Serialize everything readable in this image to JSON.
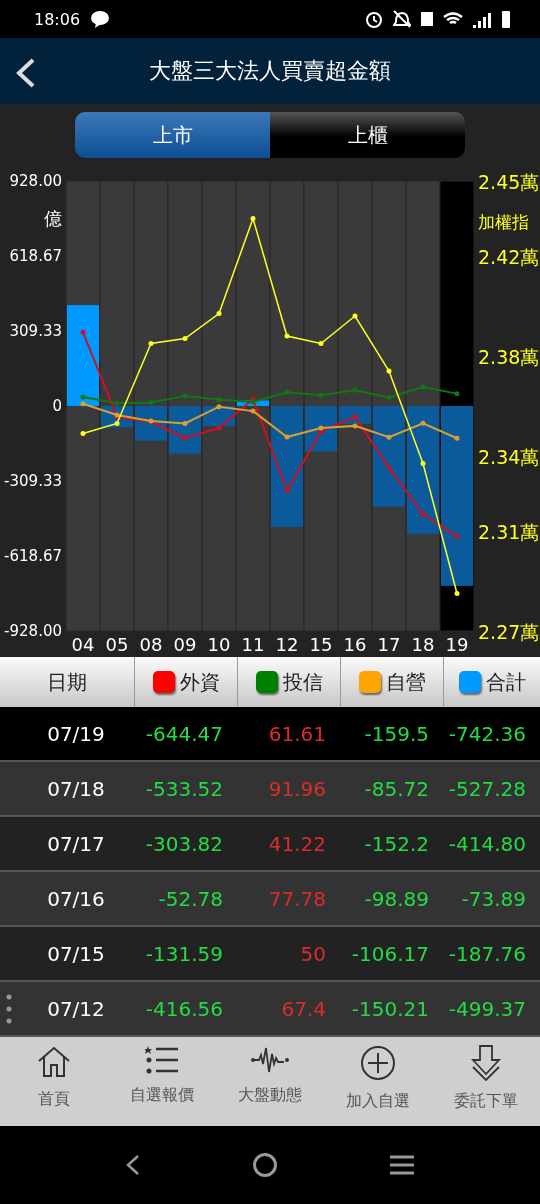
{
  "status_bar": {
    "time": "18:06"
  },
  "header": {
    "title": "大盤三大法人買賣超金額"
  },
  "tabs": [
    {
      "label": "上市",
      "selected": true
    },
    {
      "label": "上櫃",
      "selected": false
    }
  ],
  "chart": {
    "chart_data": {
      "type": "bar",
      "ylabel": "億",
      "categories": [
        "04",
        "05",
        "08",
        "09",
        "10",
        "11",
        "12",
        "15",
        "16",
        "17",
        "18",
        "19"
      ],
      "ylim": [
        -928,
        928
      ],
      "yticks": [
        {
          "value": 928,
          "label": "928.00"
        },
        {
          "value": 618.67,
          "label": "618.67"
        },
        {
          "value": 309.33,
          "label": "309.33"
        },
        {
          "value": 0,
          "label": "0"
        },
        {
          "value": -309.33,
          "label": "-309.33"
        },
        {
          "value": -618.67,
          "label": "-618.67"
        },
        {
          "value": -928,
          "label": "-928.00"
        }
      ],
      "y2lim": [
        2.27,
        2.45
      ],
      "y2ticks": [
        {
          "value": 2.45,
          "label": "2.45萬"
        },
        {
          "value": 2.42,
          "label": "2.42萬"
        },
        {
          "value": 2.38,
          "label": "2.38萬"
        },
        {
          "value": 2.34,
          "label": "2.34萬"
        },
        {
          "value": 2.31,
          "label": "2.31萬"
        },
        {
          "value": 2.27,
          "label": "2.27萬"
        }
      ],
      "series": [
        {
          "type": "bar",
          "color": "#0099ff",
          "values": [
            416,
            null,
            null,
            null,
            null,
            23,
            null,
            null,
            null,
            null,
            null,
            null
          ]
        },
        {
          "type": "bar",
          "color": "#0a5a9c",
          "values": [
            null,
            -88,
            -143,
            -197,
            -84,
            null,
            -499,
            -188,
            -74,
            -415,
            -527,
            -742
          ]
        },
        {
          "type": "line",
          "color": "#cc1122",
          "values": [
            304,
            -45,
            -65,
            -132,
            -91,
            28,
            -349,
            -105,
            -44,
            -255,
            -446,
            -538
          ]
        },
        {
          "type": "line",
          "color": "#117711",
          "values": [
            37,
            11,
            14,
            41,
            27,
            17,
            57,
            44,
            65,
            35,
            78,
            51
          ]
        },
        {
          "type": "line",
          "color": "#d9a030",
          "values": [
            9,
            -37,
            -62,
            -72,
            -3,
            -21,
            -128,
            -91,
            -82,
            -129,
            -71,
            -133
          ]
        },
        {
          "name": "加權指",
          "type": "line",
          "axis": "y2",
          "color": "#ffff22",
          "values": [
            2.349,
            2.353,
            2.385,
            2.387,
            2.397,
            2.435,
            2.388,
            2.385,
            2.396,
            2.374,
            2.337,
            2.285
          ]
        }
      ]
    }
  },
  "table": {
    "columns": [
      {
        "label": "日期"
      },
      {
        "label": "外資",
        "color": "#ff0000"
      },
      {
        "label": "投信",
        "color": "#008000"
      },
      {
        "label": "自營",
        "color": "#ffa500"
      },
      {
        "label": "合計",
        "color": "#0099ff"
      }
    ],
    "rows": [
      {
        "selected": true,
        "cells": [
          "07/19",
          "-644.47",
          "61.61",
          "-159.5",
          "-742.36"
        ]
      },
      {
        "selected": false,
        "cells": [
          "07/18",
          "-533.52",
          "91.96",
          "-85.72",
          "-527.28"
        ]
      },
      {
        "selected": false,
        "cells": [
          "07/17",
          "-303.82",
          "41.22",
          "-152.2",
          "-414.80"
        ]
      },
      {
        "selected": false,
        "cells": [
          "07/16",
          "-52.78",
          "77.78",
          "-98.89",
          "-73.89"
        ]
      },
      {
        "selected": false,
        "cells": [
          "07/15",
          "-131.59",
          "50",
          "-106.17",
          "-187.76"
        ]
      },
      {
        "selected": false,
        "handle": true,
        "cells": [
          "07/12",
          "-416.56",
          "67.4",
          "-150.21",
          "-499.37"
        ]
      }
    ]
  },
  "bottom_nav": [
    {
      "label": "首頁"
    },
    {
      "label": "自選報價"
    },
    {
      "label": "大盤動態"
    },
    {
      "label": "加入自選"
    },
    {
      "label": "委託下單"
    }
  ]
}
